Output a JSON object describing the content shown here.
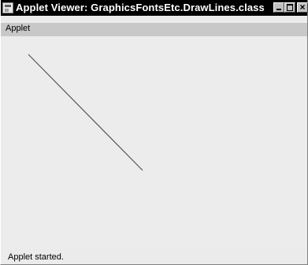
{
  "window": {
    "title": "Applet Viewer: GraphicsFontsEtc.DrawLines.class",
    "app_icon": "applet-viewer-icon",
    "controls": {
      "minimize_icon": "minimize-icon",
      "maximize_icon": "maximize-icon",
      "close_icon": "close-icon",
      "close_glyph": "×"
    }
  },
  "menubar": {
    "items": [
      {
        "label": "Applet"
      }
    ]
  },
  "status": {
    "text": "Applet started."
  },
  "colors": {
    "titlebar": "#000000",
    "menubar": "#c8c8c8",
    "canvas": "#ececec",
    "line": "#555555"
  }
}
